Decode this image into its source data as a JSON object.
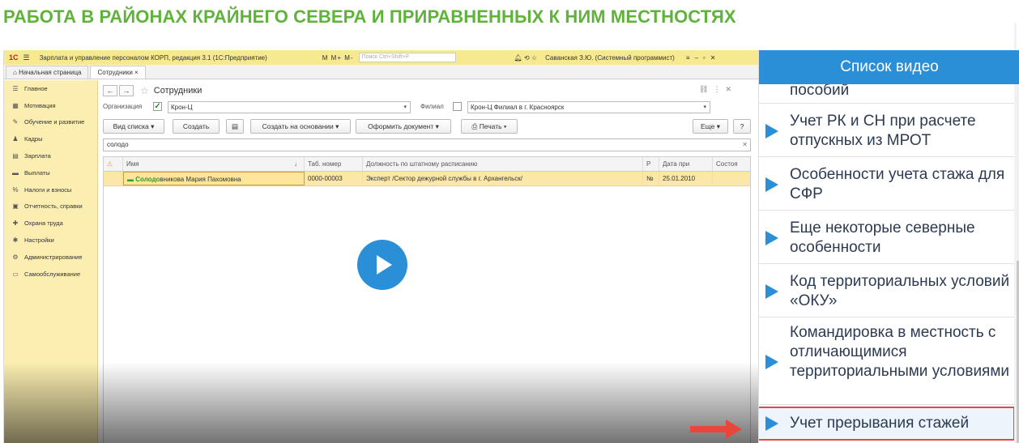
{
  "page_title": "РАБОТА В РАЙОНАХ КРАЙНЕГО СЕВЕРА И ПРИРАВНЕННЫХ К НИМ МЕСТНОСТЯХ",
  "app": {
    "logo": "1С",
    "title": "Зарплата и управление персоналом КОРП, редакция 3.1  (1С:Предприятие)",
    "mbuttons": "M  M+  M-",
    "search_placeholder": "Поиск Ctrl+Shift+F",
    "user": "Саванская З.Ю. (Системный программист)"
  },
  "tabs": [
    {
      "label": "Начальная страница"
    },
    {
      "label": "Сотрудники ×"
    }
  ],
  "nav": [
    {
      "icon": "☰",
      "label": "Главное"
    },
    {
      "icon": "▦",
      "label": "Мотивация"
    },
    {
      "icon": "✎",
      "label": "Обучение и развитие"
    },
    {
      "icon": "♟",
      "label": "Кадры"
    },
    {
      "icon": "▤",
      "label": "Зарплата"
    },
    {
      "icon": "▬",
      "label": "Выплаты"
    },
    {
      "icon": "%",
      "label": "Налоги и взносы"
    },
    {
      "icon": "▣",
      "label": "Отчетность, справки"
    },
    {
      "icon": "✚",
      "label": "Охрана труда"
    },
    {
      "icon": "✱",
      "label": "Настройки"
    },
    {
      "icon": "⚙",
      "label": "Администрирование"
    },
    {
      "icon": "▭",
      "label": "Самообслуживание"
    }
  ],
  "form": {
    "title": "Сотрудники",
    "org_label": "Организация",
    "org_value": "Крон-Ц",
    "branch_label": "Филиал",
    "branch_value": "Крон-Ц Филиал в г. Красноярск",
    "buttons": {
      "view": "Вид списка  ▾",
      "create": "Создать",
      "create_based": "Создать на основании  ▾",
      "issue_doc": "Оформить документ  ▾",
      "print": "Печать  ▾",
      "more": "Еще  ▾",
      "help": "?"
    },
    "search_value": "солодо",
    "columns": [
      "Имя",
      "Таб. номер",
      "Должность по штатному расписанию",
      "Р",
      "Дата при",
      "Состоя"
    ],
    "row": {
      "name_highlight": "Солодо",
      "name_rest": "вникова Мария Пахомовна",
      "tab_number": "0000-00003",
      "position": "Эксперт /Сектор дежурной службы в г. Архангельск/",
      "r": "№",
      "date": "25.01.2010",
      "state": ""
    }
  },
  "panel": {
    "header": "Список видео",
    "items": [
      {
        "title": "пособий"
      },
      {
        "title": "Учет РК и СН при расчете отпускных из МРОТ"
      },
      {
        "title": "Особенности учета стажа для СФР"
      },
      {
        "title": "Еще некоторые северные особенности"
      },
      {
        "title": "Код территориальных условий «ОКУ»"
      },
      {
        "title": "Командировка в местность с отличающимися территориальными условиями"
      },
      {
        "title": "Учет прерывания стажей"
      }
    ]
  },
  "colors": {
    "accent": "#2b8fd8",
    "title_green": "#5fb33a",
    "highlight_red": "#e14a4a"
  }
}
